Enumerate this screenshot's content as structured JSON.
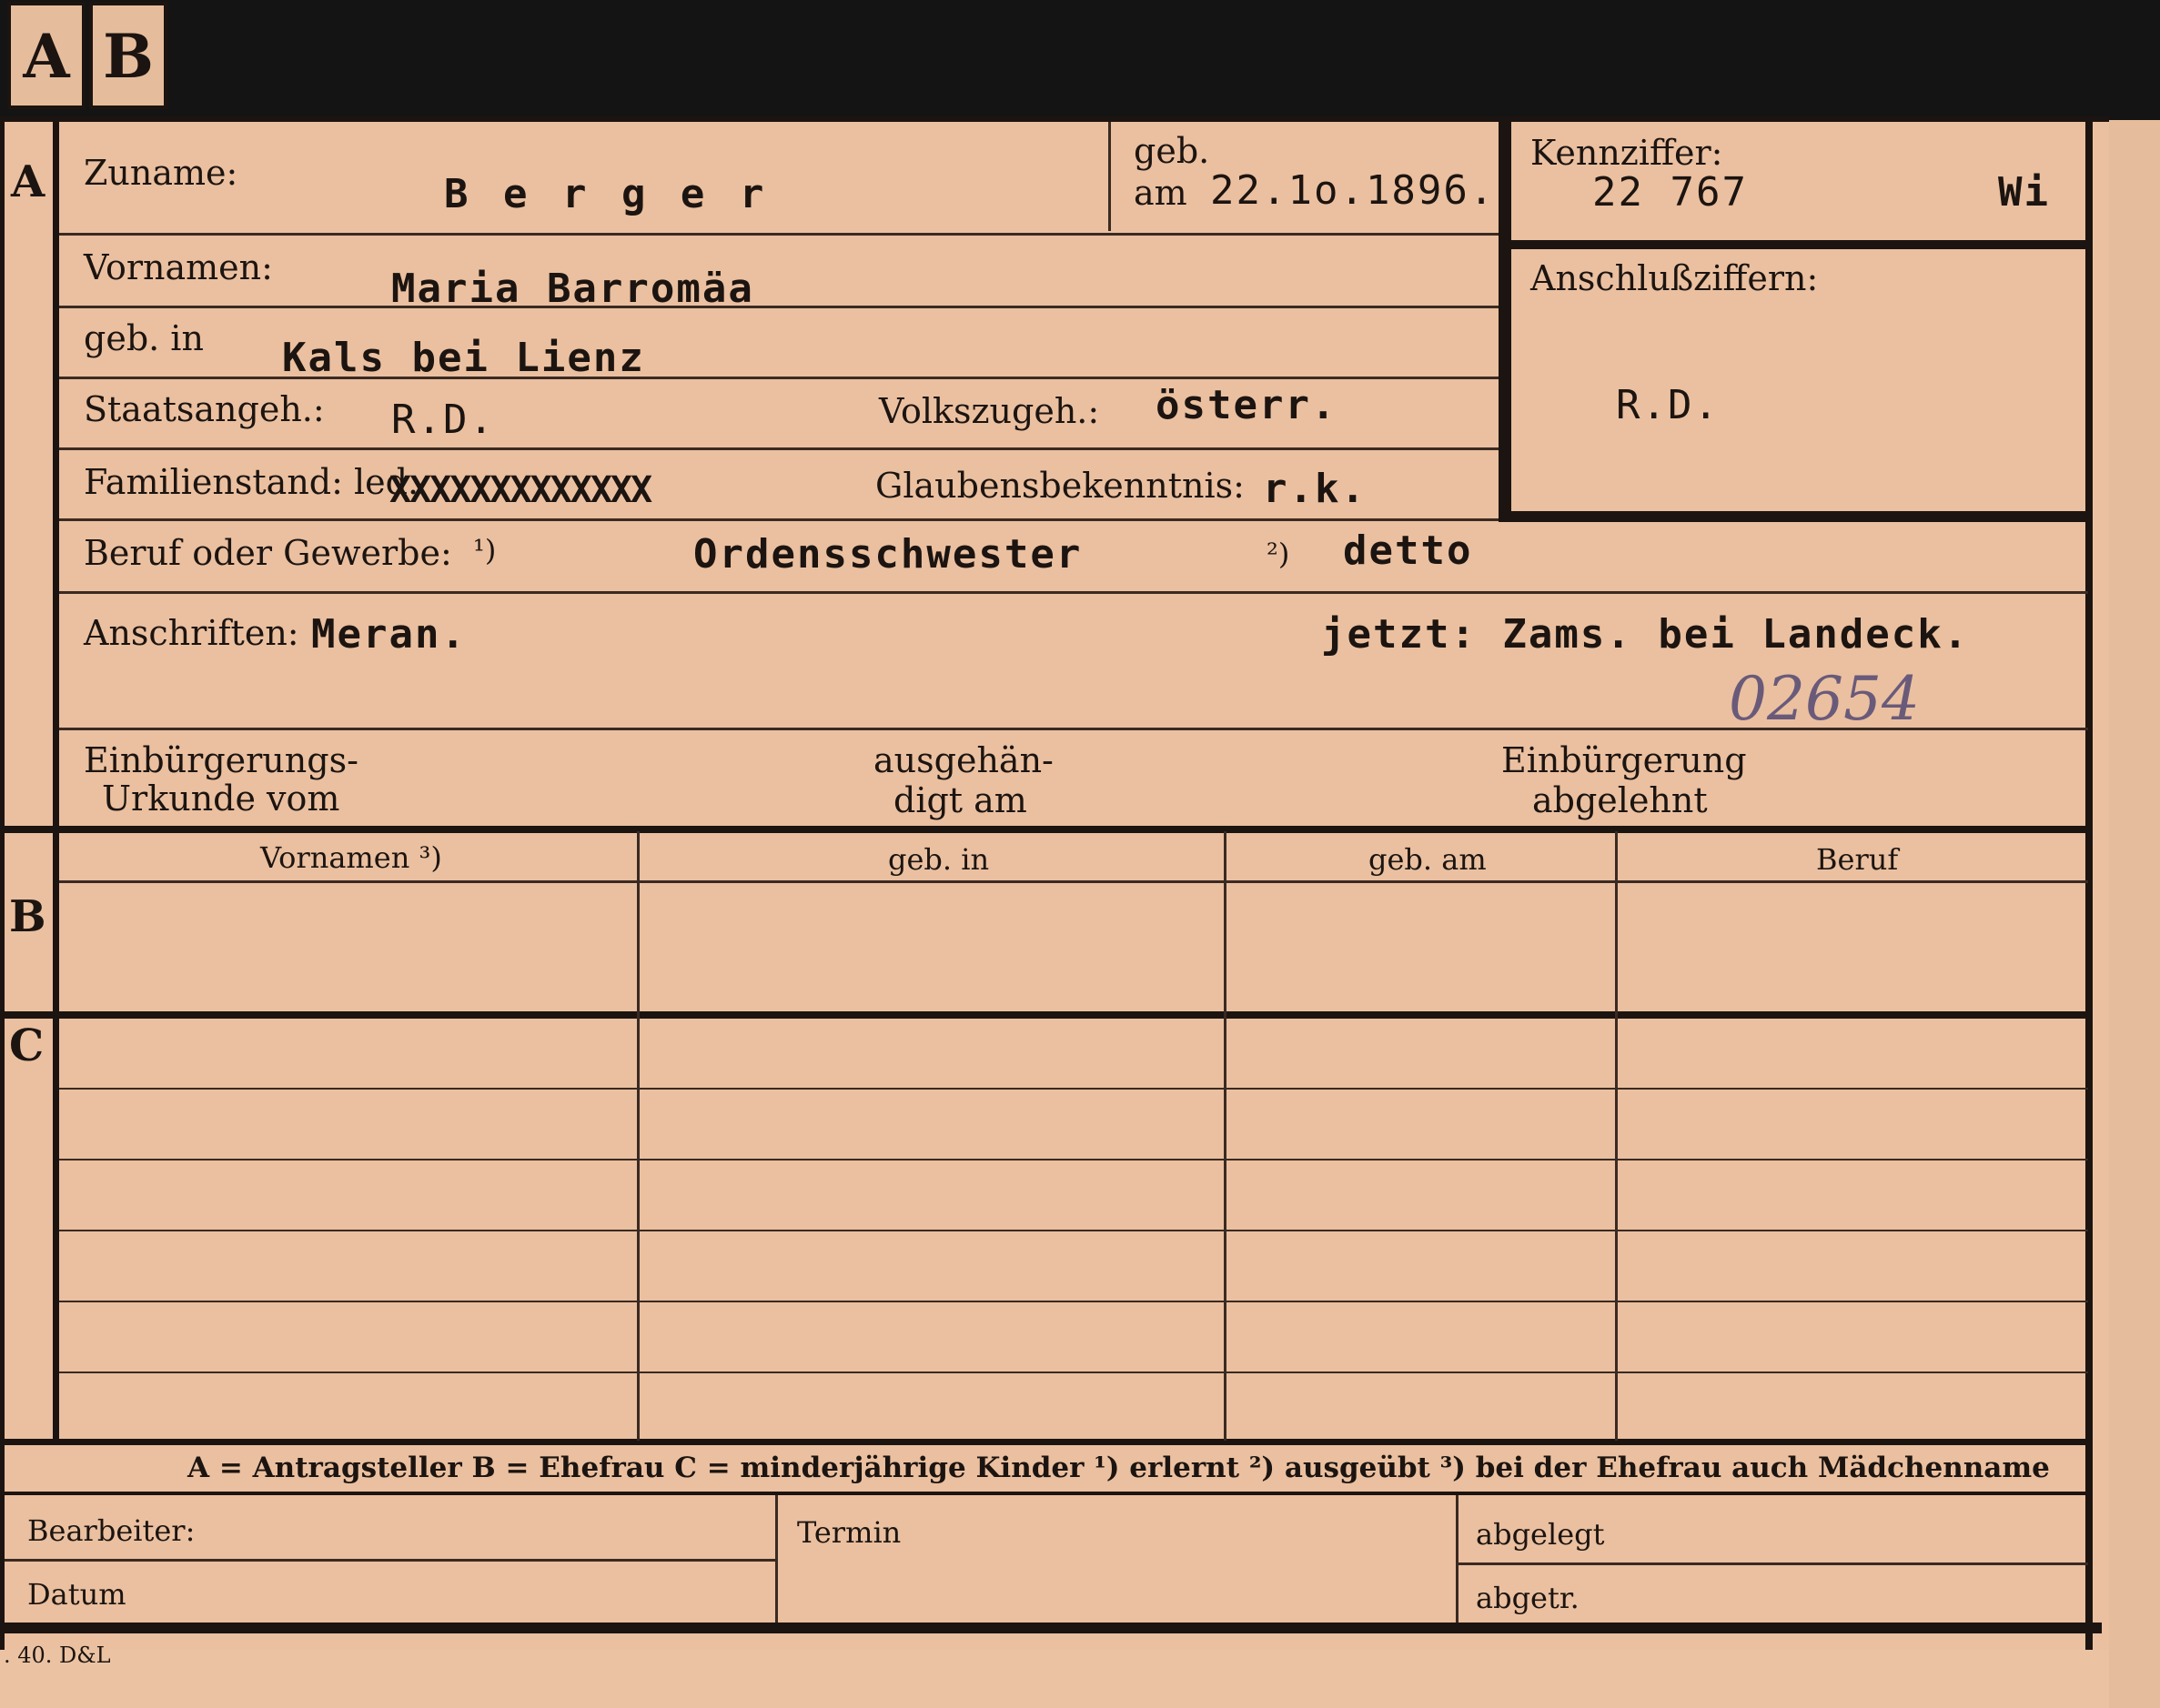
{
  "tabs": [
    "A",
    "B"
  ],
  "sections": [
    "A",
    "B",
    "C"
  ],
  "labels": {
    "zuname": "Zuname:",
    "geb": "geb.",
    "am": "am",
    "kennziffer": "Kennziffer:",
    "vornamen": "Vornamen:",
    "anschlussziffern": "Anschlußziffern:",
    "geb_in": "geb. in",
    "staatsangeh": "Staatsangeh.:",
    "volkszugeh": "Volkszugeh.:",
    "familienstand": "Familienstand: led.",
    "glaubensbekenntnis": "Glaubensbekenntnis:",
    "beruf": "Beruf oder Gewerbe:",
    "fn1": "¹)",
    "fn2": "²)",
    "anschriften": "Anschriften:",
    "einb_urkunde_1": "Einbürgerungs-",
    "einb_urkunde_2": "Urkunde vom",
    "ausgehaendigt_1": "ausgehän-",
    "ausgehaendigt_2": "digt am",
    "einb_abgelehnt_1": "Einbürgerung",
    "einb_abgelehnt_2": "abgelehnt",
    "bearbeiter": "Bearbeiter:",
    "termin": "Termin",
    "abgelegt": "abgelegt",
    "datum": "Datum",
    "abgetr": "abgetr."
  },
  "values": {
    "zuname": "B e r g e r",
    "geb_am": "22.1o.1896.",
    "kennziffer": "22 767",
    "kennziffer_suffix": "Wi",
    "vornamen": "Maria Barromäa",
    "geb_in": "Kals bei Lienz",
    "staatsangeh": "R.D.",
    "volkszugeh": "österr.",
    "familienstand_struck": "XXXXXXXXXXXXX",
    "glaubensbekenntnis": "r.k.",
    "anschluss": "R.D.",
    "beruf_erlernt": "Ordensschwester",
    "beruf_ausgeuebt": "detto",
    "anschrift_1": "Meran.",
    "anschrift_2": "jetzt: Zams. bei Landeck.",
    "handwritten_number": "02654"
  },
  "table": {
    "headers": [
      "Vornamen ³)",
      "geb. in",
      "geb. am",
      "Beruf"
    ],
    "rows_b": 1,
    "rows_c": 6
  },
  "footer_legend": "A = Antragsteller   B = Ehefrau   C = minderjährige Kinder   ¹) erlernt   ²) ausgeübt   ³) bei der Ehefrau auch Mädchenname",
  "printer_mark": ". 40. D&L"
}
